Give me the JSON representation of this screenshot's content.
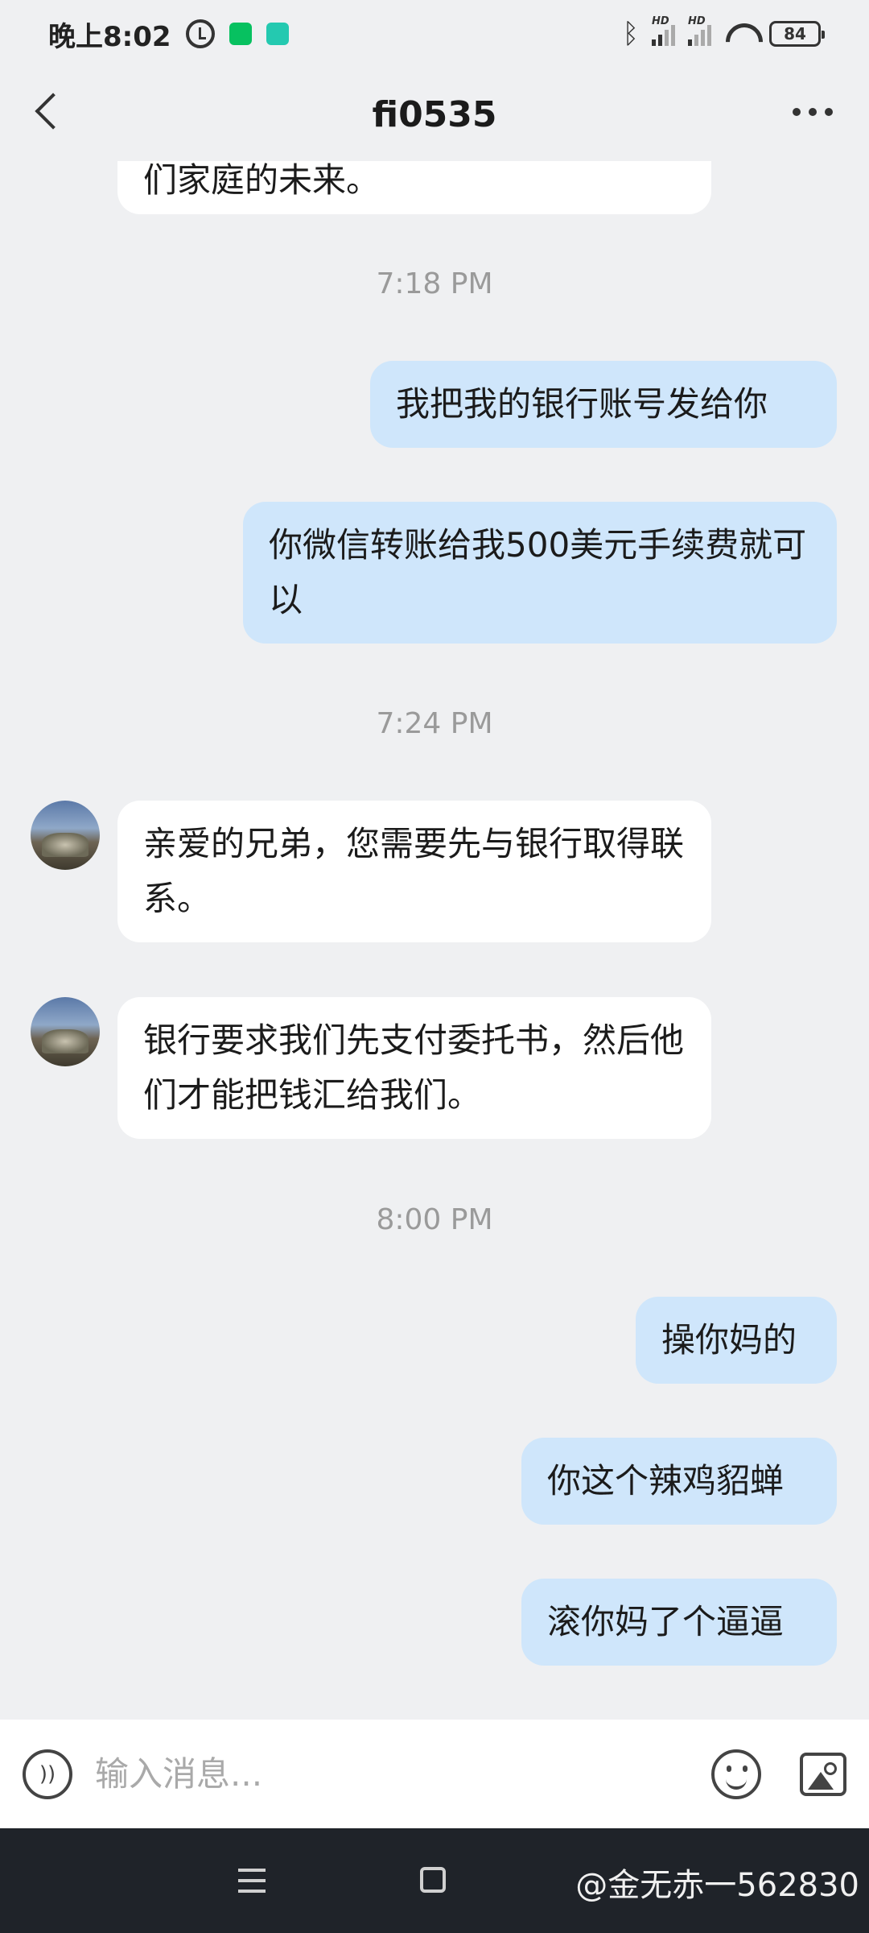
{
  "status_bar": {
    "time": "晚上8:02",
    "battery": "84",
    "signal_label": "HD"
  },
  "header": {
    "title": "fi0535"
  },
  "messages": [
    {
      "type": "incoming",
      "text": "们家庭的未来。"
    },
    {
      "type": "timestamp",
      "text": "7:18 PM"
    },
    {
      "type": "outgoing",
      "text": "我把我的银行账号发给你"
    },
    {
      "type": "outgoing",
      "text": "你微信转账给我500美元手续费就可以"
    },
    {
      "type": "timestamp",
      "text": "7:24 PM"
    },
    {
      "type": "incoming",
      "text": "亲爱的兄弟，您需要先与银行取得联系。"
    },
    {
      "type": "incoming",
      "text": "银行要求我们先支付委托书，然后他们才能把钱汇给我们。"
    },
    {
      "type": "timestamp",
      "text": "8:00 PM"
    },
    {
      "type": "outgoing",
      "text": "操你妈的"
    },
    {
      "type": "outgoing",
      "text": "你这个辣鸡貂蝉"
    },
    {
      "type": "outgoing",
      "text": "滚你妈了个逼逼"
    }
  ],
  "input": {
    "placeholder": "输入消息..."
  },
  "watermark": "@金无赤一562830",
  "colors": {
    "background": "#eff0f2",
    "incoming_bubble": "#ffffff",
    "outgoing_bubble": "#cfe6fb",
    "nav_bar": "#1f2329"
  }
}
